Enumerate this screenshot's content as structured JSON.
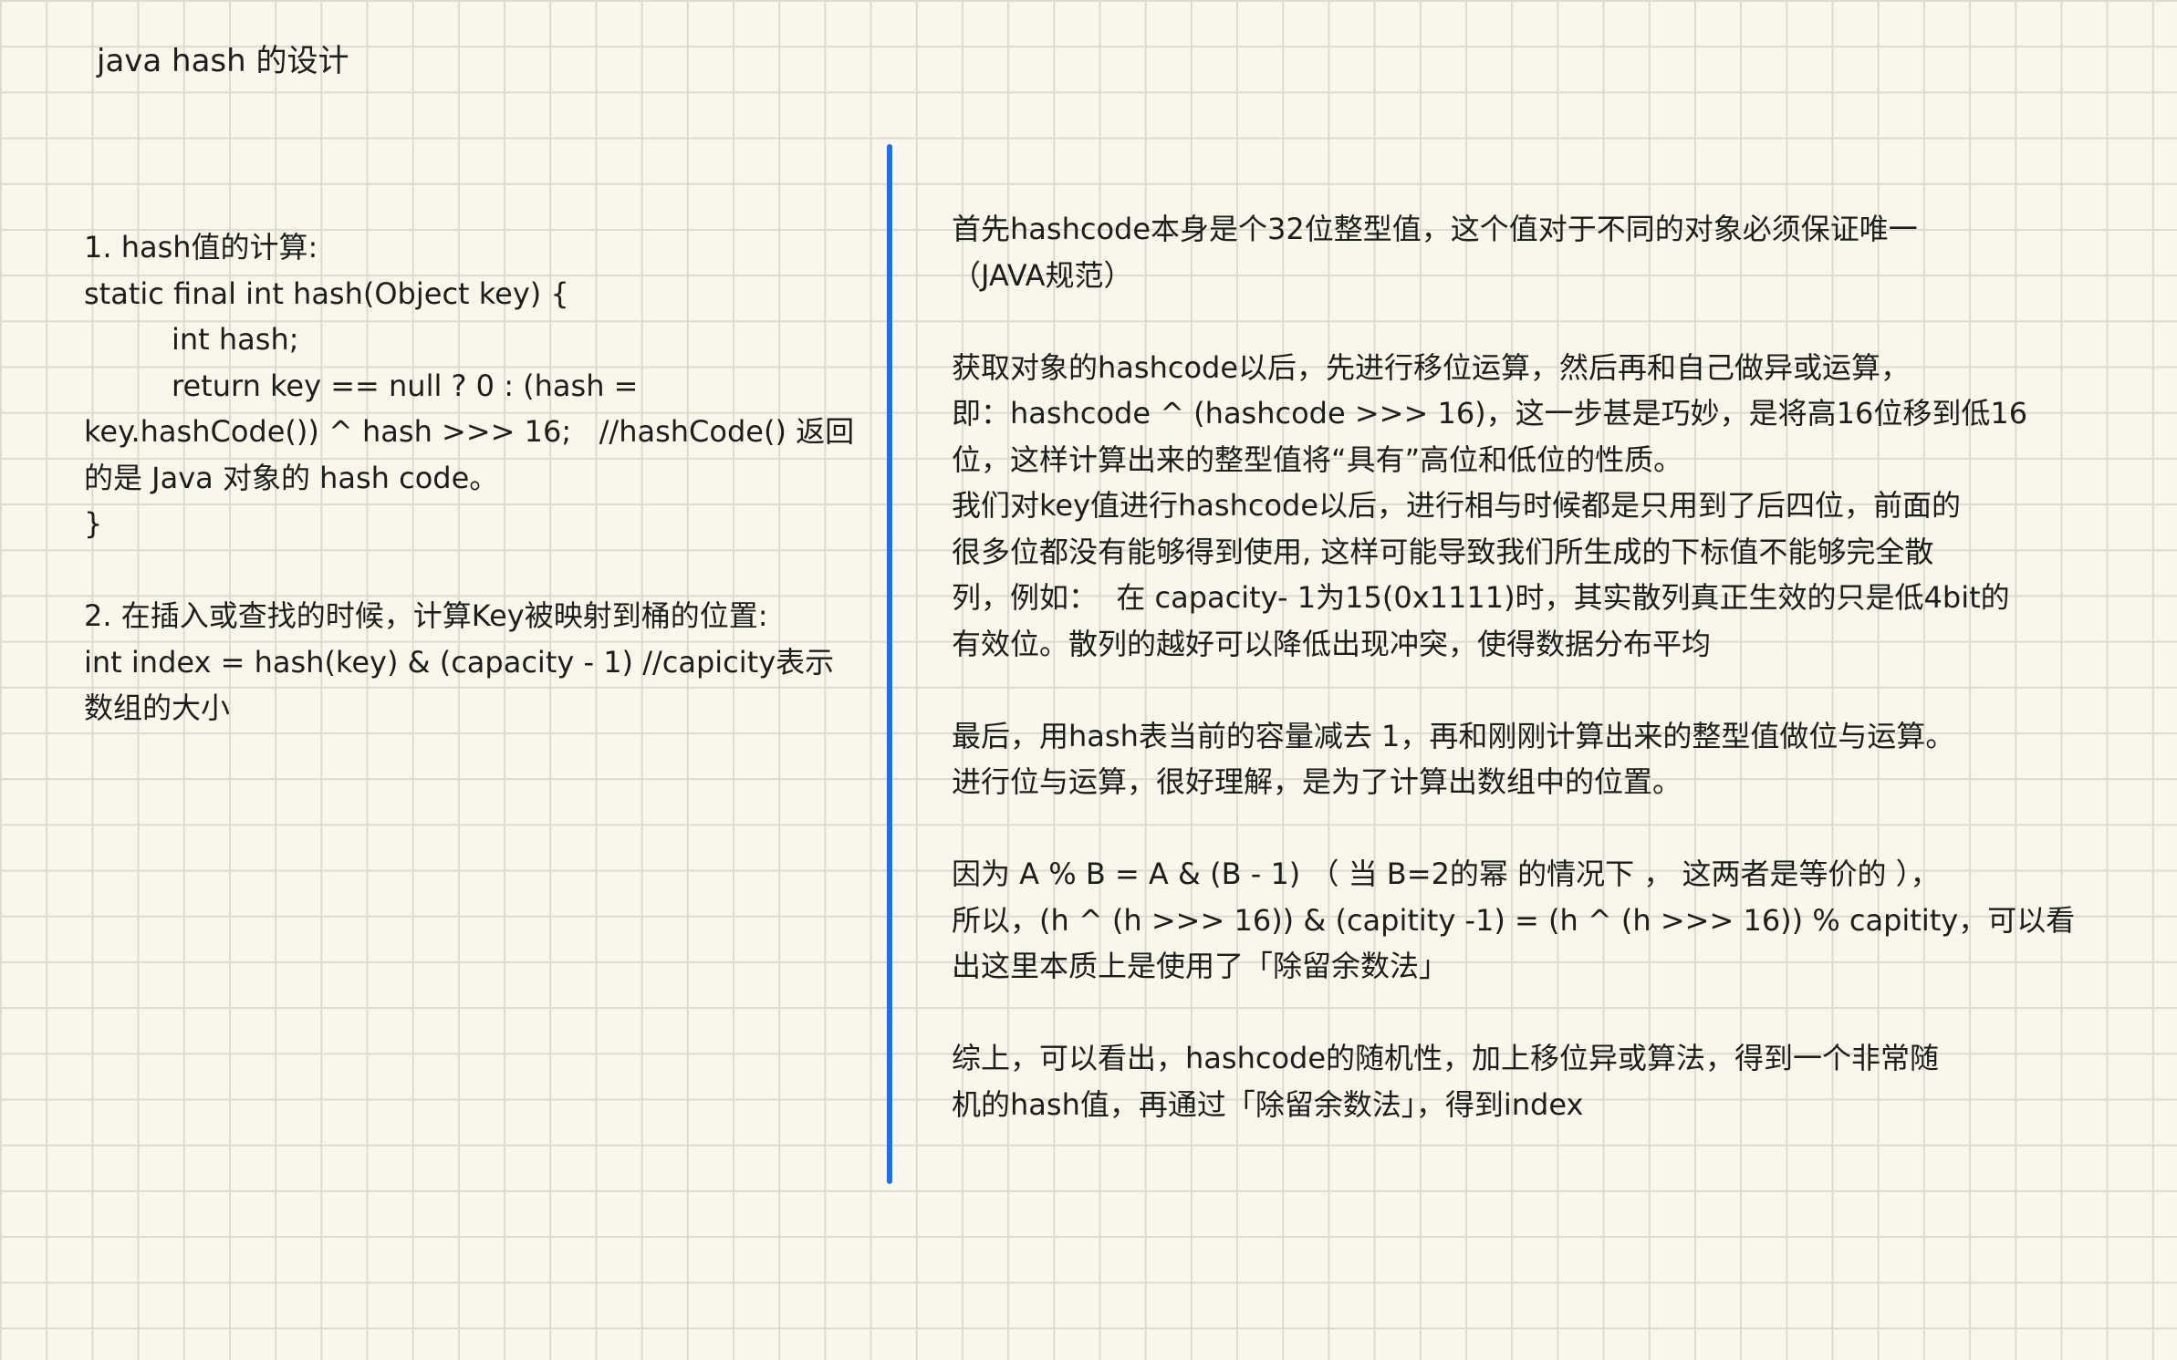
{
  "title": "java hash 的设计",
  "left": {
    "section1": {
      "lines": [
        "1. hash值的计算:",
        "static final int hash(Object key) {",
        "int hash;",
        "return key == null ? 0 : (hash =",
        "key.hashCode()) ^ hash >>> 16;   //hashCode() 返回",
        "的是 Java 对象的 hash code。",
        "}"
      ]
    },
    "section2": {
      "lines": [
        "2. 在插入或查找的时候，计算Key被映射到桶的位置:",
        "int index = hash(key) & (capacity - 1) //capicity表示",
        "数组的大小"
      ]
    }
  },
  "right": {
    "p1": [
      "首先hashcode本身是个32位整型值，这个值对于不同的对象必须保证唯一",
      "（JAVA规范）"
    ],
    "p2": [
      "获取对象的hashcode以后，先进行移位运算，然后再和自己做异或运算，",
      "即：hashcode ^ (hashcode >>> 16)，这一步甚是巧妙，是将高16位移到低16",
      "位，这样计算出来的整型值将“具有”高位和低位的性质。",
      "我们对key值进行hashcode以后，进行相与时候都是只用到了后四位，前面的",
      "很多位都没有能够得到使用, 这样可能导致我们所生成的下标值不能够完全散",
      "列，例如：  在 capacity- 1为15(0x1111)时，其实散列真正生效的只是低4bit的",
      "有效位。散列的越好可以降低出现冲突，使得数据分布平均"
    ],
    "p3": [
      "最后，用hash表当前的容量减去 1，再和刚刚计算出来的整型值做位与运算。",
      "进行位与运算，很好理解，是为了计算出数组中的位置。"
    ],
    "p4": [
      "因为 A % B = A & (B - 1) （ 当 B=2的幂 的情况下 ， 这两者是等价的 ），",
      "所以，(h ^ (h >>> 16)) & (capitity -1) = (h ^ (h >>> 16)) % capitity，可以看",
      "出这里本质上是使用了「除留余数法」"
    ],
    "p5": [
      "综上，可以看出，hashcode的随机性，加上移位异或算法，得到一个非常随",
      "机的hash值，再通过「除留余数法」，得到index"
    ]
  },
  "colors": {
    "background": "#f9f7ea",
    "grid": "#dcdbcf",
    "divider": "#1a73e0",
    "text": "#1d1d1d"
  }
}
